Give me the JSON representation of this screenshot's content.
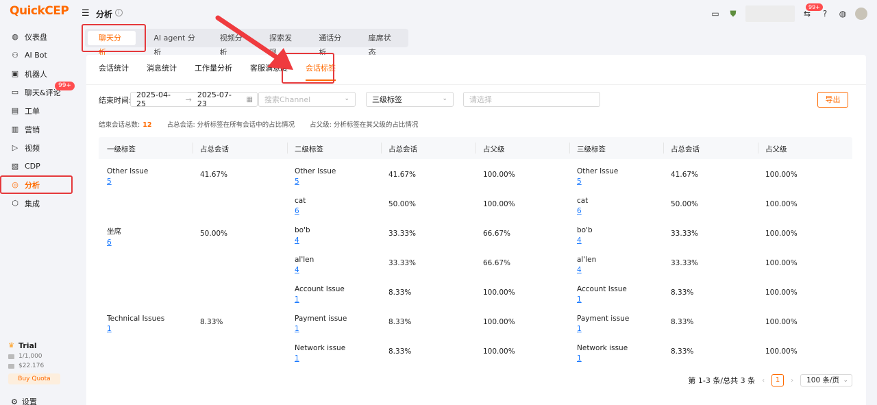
{
  "app": {
    "logo": "QuickCEP"
  },
  "sidebar": {
    "items": [
      {
        "label": "仪表盘",
        "icon": "dashboard-icon",
        "glyph": "◍"
      },
      {
        "label": "AI Bot",
        "icon": "ai-bot-icon",
        "glyph": "⚇"
      },
      {
        "label": "机器人",
        "icon": "robot-icon",
        "glyph": "▣"
      },
      {
        "label": "聊天&评论",
        "icon": "chat-icon",
        "glyph": "▭",
        "badge": "99+"
      },
      {
        "label": "工单",
        "icon": "ticket-icon",
        "glyph": "▤"
      },
      {
        "label": "营销",
        "icon": "marketing-icon",
        "glyph": "▥"
      },
      {
        "label": "视频",
        "icon": "video-icon",
        "glyph": "▷"
      },
      {
        "label": "CDP",
        "icon": "cdp-icon",
        "glyph": "▧"
      },
      {
        "label": "分析",
        "icon": "analysis-icon",
        "glyph": "◎",
        "active": true
      },
      {
        "label": "集成",
        "icon": "integration-icon",
        "glyph": "⬡"
      }
    ],
    "trial": {
      "title": "Trial",
      "usage": "1/1,000",
      "balance": "$22.176",
      "buy_label": "Buy Quota"
    },
    "settings_label": "设置"
  },
  "header": {
    "title": "分析",
    "notification_badge": "99+"
  },
  "top_tabs": [
    {
      "label": "聊天分析",
      "active": true
    },
    {
      "label": "AI agent 分析"
    },
    {
      "label": "视频分析"
    },
    {
      "label": "探索发现"
    },
    {
      "label": "通话分析"
    },
    {
      "label": "座席状态"
    }
  ],
  "sub_tabs": [
    {
      "label": "会话统计"
    },
    {
      "label": "消息统计"
    },
    {
      "label": "工作量分析"
    },
    {
      "label": "客服满意度"
    },
    {
      "label": "会话标签",
      "active": true
    }
  ],
  "filters": {
    "date_label": "结束时间:",
    "start_date": "2025-04-25",
    "end_date": "2025-07-23",
    "channel_placeholder": "搜索Channel",
    "level_select": "三级标签",
    "choose_placeholder": "请选择",
    "export_label": "导出"
  },
  "summary": {
    "total_label": "结束会话总数:",
    "total_value": "12",
    "note1": "占总会话: 分析标签在所有会话中的占比情况",
    "note2": "占父级: 分析标签在其父级的占比情况"
  },
  "table": {
    "headers": [
      "一级标签",
      "占总会话",
      "二级标签",
      "占总会话",
      "占父级",
      "三级标签",
      "占总会话",
      "占父级"
    ],
    "level1": [
      {
        "name": "Other Issue",
        "count": "5",
        "pct": "41.67%"
      },
      {
        "name": "坐席",
        "count": "6",
        "pct": "50.00%"
      },
      {
        "name": "Technical Issues",
        "count": "1",
        "pct": "8.33%"
      }
    ],
    "rows": [
      {
        "l2": "Other Issue",
        "l2c": "5",
        "l2p": "41.67%",
        "l2f": "100.00%",
        "l3": "Other Issue",
        "l3c": "5",
        "l3p": "41.67%",
        "l3f": "100.00%"
      },
      {
        "l2": "cat",
        "l2c": "6",
        "l2p": "50.00%",
        "l2f": "100.00%",
        "l3": "cat",
        "l3c": "6",
        "l3p": "50.00%",
        "l3f": "100.00%"
      },
      {
        "l2": "bo'b",
        "l2c": "4",
        "l2p": "33.33%",
        "l2f": "66.67%",
        "l3": "bo'b",
        "l3c": "4",
        "l3p": "33.33%",
        "l3f": "100.00%"
      },
      {
        "l2": "al'len",
        "l2c": "4",
        "l2p": "33.33%",
        "l2f": "66.67%",
        "l3": "al'len",
        "l3c": "4",
        "l3p": "33.33%",
        "l3f": "100.00%"
      },
      {
        "l2": "Account Issue",
        "l2c": "1",
        "l2p": "8.33%",
        "l2f": "100.00%",
        "l3": "Account Issue",
        "l3c": "1",
        "l3p": "8.33%",
        "l3f": "100.00%"
      },
      {
        "l2": "Payment issue",
        "l2c": "1",
        "l2p": "8.33%",
        "l2f": "100.00%",
        "l3": "Payment issue",
        "l3c": "1",
        "l3p": "8.33%",
        "l3f": "100.00%"
      },
      {
        "l2": "Network issue",
        "l2c": "1",
        "l2p": "8.33%",
        "l2f": "100.00%",
        "l3": "Network issue",
        "l3c": "1",
        "l3p": "8.33%",
        "l3f": "100.00%"
      }
    ]
  },
  "pagination": {
    "range_text": "第 1-3 条/总共 3 条",
    "current_page": "1",
    "page_size": "100 条/页"
  }
}
